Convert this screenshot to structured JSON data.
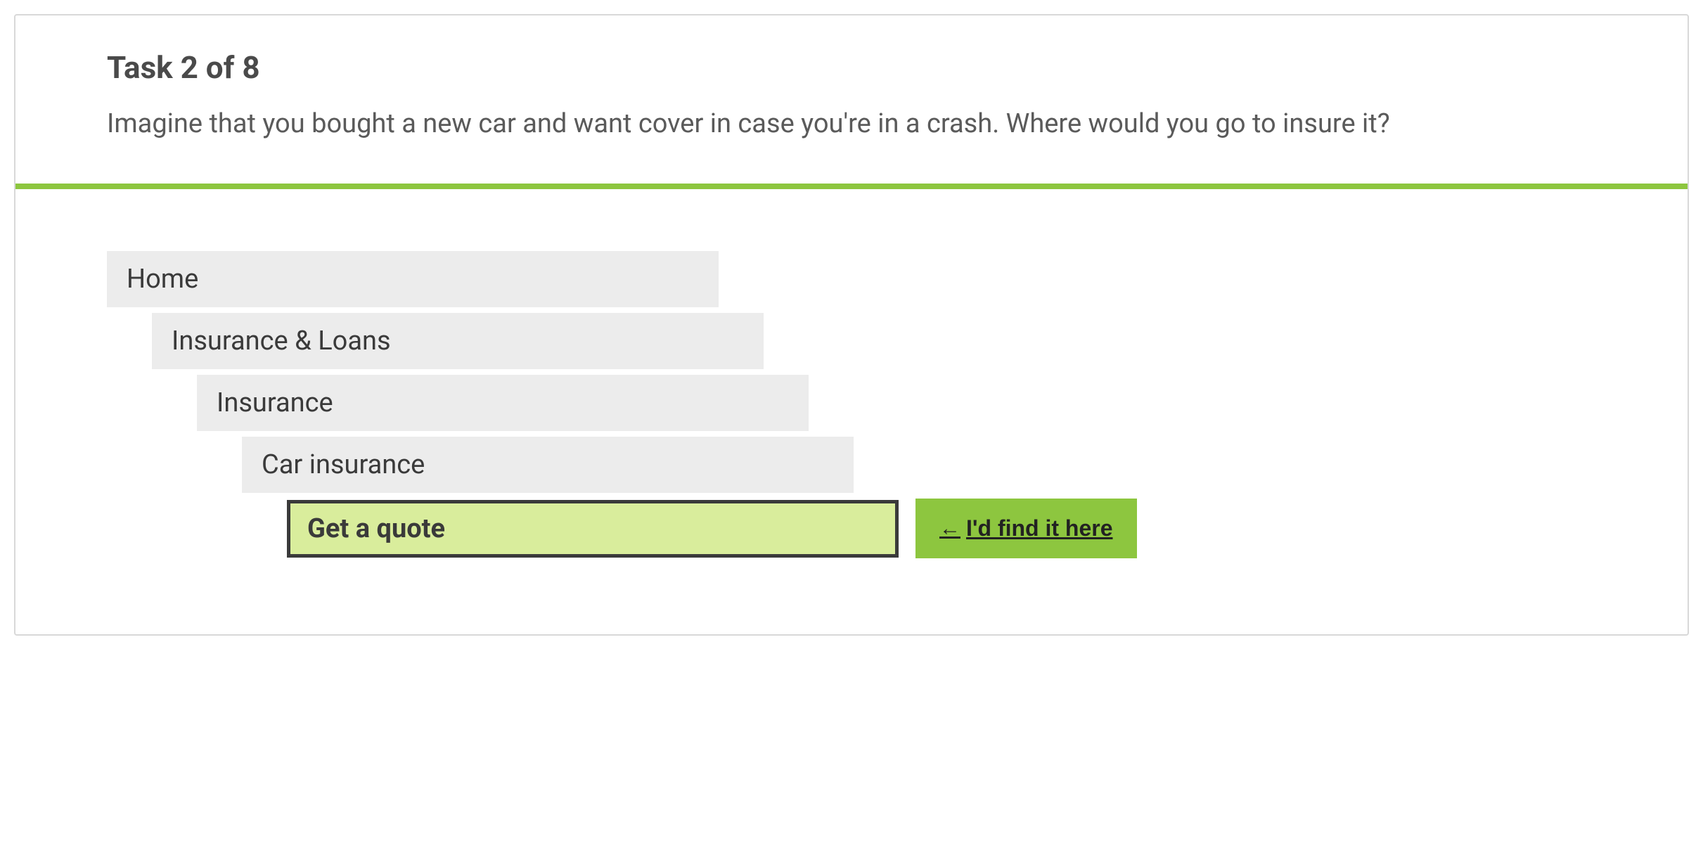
{
  "header": {
    "title": "Task 2 of 8",
    "description": "Imagine that you bought a new car and want cover in case you're in a crash. Where would you go to insure it?"
  },
  "tree": {
    "items": [
      {
        "label": "Home",
        "indent": 0,
        "selected": false
      },
      {
        "label": "Insurance & Loans",
        "indent": 1,
        "selected": false
      },
      {
        "label": "Insurance",
        "indent": 2,
        "selected": false
      },
      {
        "label": "Car insurance",
        "indent": 3,
        "selected": false
      },
      {
        "label": "Get a quote",
        "indent": 4,
        "selected": true
      }
    ]
  },
  "action": {
    "find_here_label": " I'd find it here",
    "arrow": "←"
  },
  "colors": {
    "accent": "#8dc63f",
    "highlight": "#d9ed9c",
    "item_bg": "#ececec",
    "text": "#4a4a4a"
  }
}
